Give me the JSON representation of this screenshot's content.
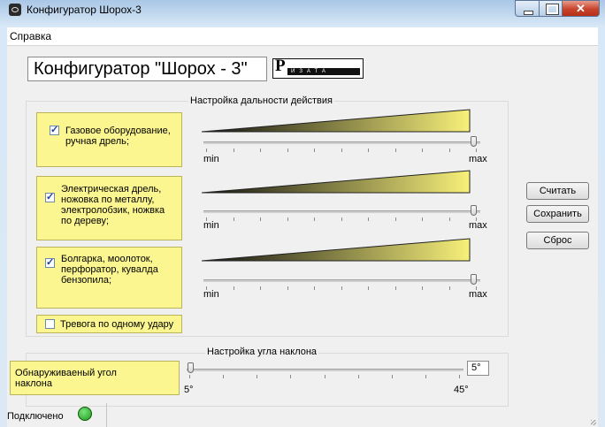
{
  "window": {
    "title": "Конфигуратор Шорох-3",
    "close_glyph": "✕"
  },
  "menu": {
    "items": [
      "Справка"
    ]
  },
  "header": {
    "title": "Конфигуратор \"Шорох - 3\"",
    "logo_letter": "Р",
    "logo_text": "ИЗАТА"
  },
  "range_group": {
    "legend": "Настройка дальности действия",
    "min_label": "min",
    "max_label": "max",
    "channels": [
      {
        "label": "Газовое оборудование, ручная дрель;",
        "checked": true,
        "slider_level": 1.0
      },
      {
        "label": "Электрическая дрель, ножовка по металлу, электролобзик, ножвка по дереву;",
        "checked": true,
        "slider_level": 1.0
      },
      {
        "label": "Болгарка, моолоток, перфоратор, кувалда бензопила;",
        "checked": true,
        "slider_level": 1.0
      }
    ],
    "single_hit_alarm": {
      "label": "Тревога по одному удару",
      "checked": false
    }
  },
  "angle_group": {
    "legend": "Настройка угла наклона",
    "label": "Обнаруживаеный угол наклона",
    "min_label": "5°",
    "max_label": "45°",
    "value": "5°",
    "slider_level": 0.0
  },
  "buttons": {
    "read": "Считать",
    "save": "Сохранить",
    "reset": "Сброс"
  },
  "status": {
    "label": "Подключено",
    "indicator_color": "#2fb52f"
  },
  "colors": {
    "highlight": "#fbf68f",
    "ramp_start": "#111111",
    "ramp_end": "#f7f07a"
  }
}
